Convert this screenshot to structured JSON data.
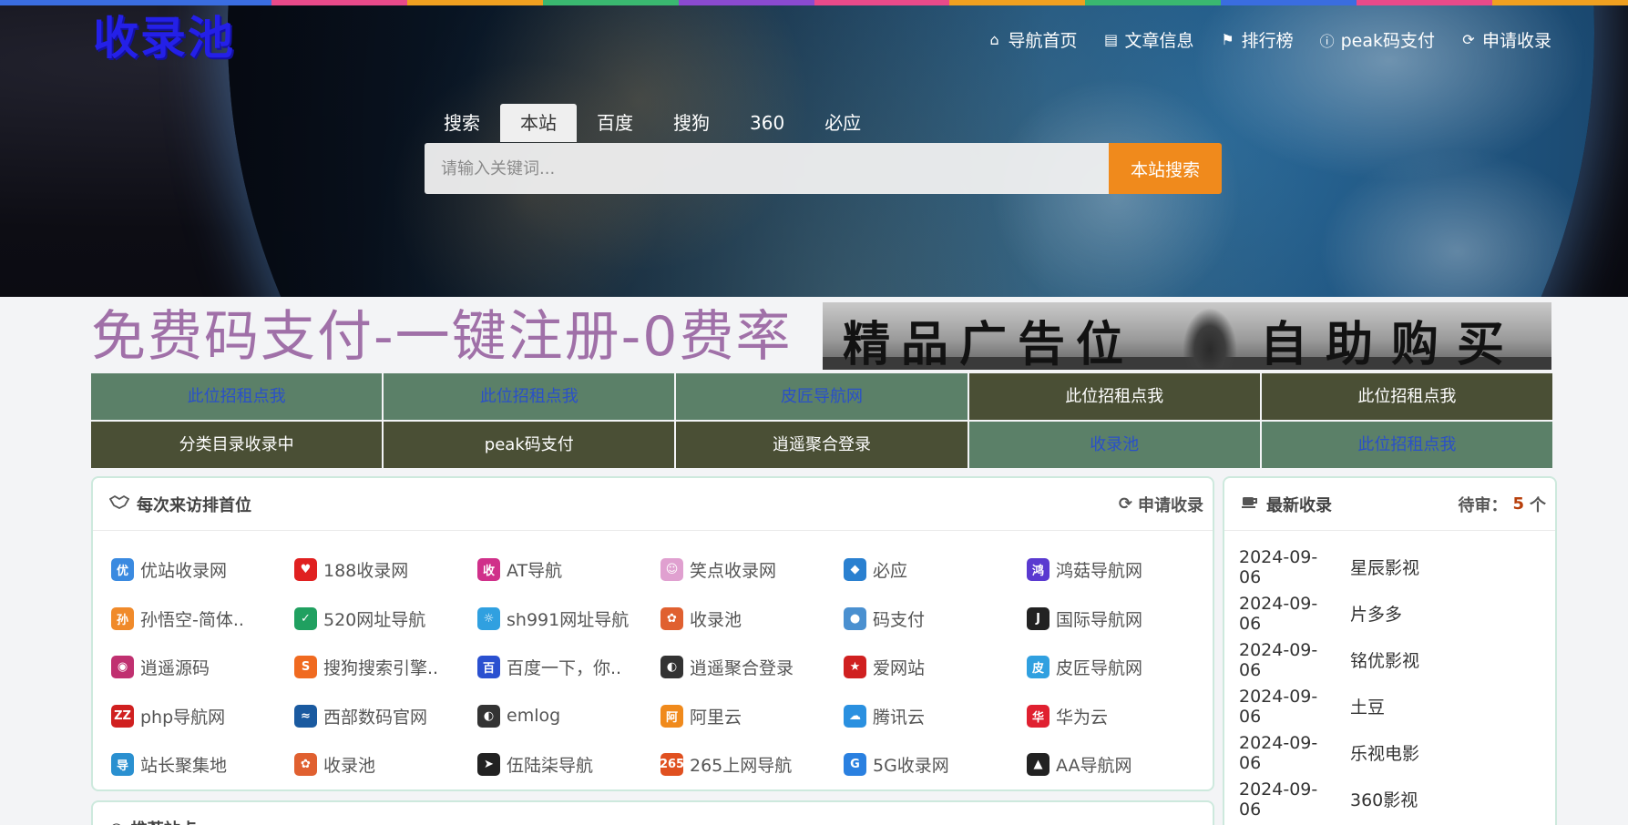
{
  "top_strip_colors": [
    "#3a6de0",
    "#3a6de0",
    "#e84a8a",
    "#f0a020",
    "#3ab870",
    "#8a4ad0",
    "#e84a8a",
    "#f0a020",
    "#3ab870",
    "#3a6de0",
    "#e84a8a",
    "#f0a020"
  ],
  "header": {
    "logo_text": "收录池",
    "nav": [
      {
        "icon": "home-icon",
        "glyph": "⌂",
        "label": "导航首页"
      },
      {
        "icon": "book-icon",
        "glyph": "▤",
        "label": "文章信息"
      },
      {
        "icon": "flag-icon",
        "glyph": "⚑",
        "label": "排行榜"
      },
      {
        "icon": "info-icon",
        "glyph": "ⓘ",
        "label": "peak码支付"
      },
      {
        "icon": "refresh-icon",
        "glyph": "⟳",
        "label": "申请收录"
      }
    ]
  },
  "search": {
    "tabs": [
      "搜索",
      "本站",
      "百度",
      "搜狗",
      "360",
      "必应"
    ],
    "active_tab": "本站",
    "placeholder": "请输入关键词...",
    "button_label": "本站搜索"
  },
  "ads": {
    "left_text": "免费码支付-一键注册-0费率",
    "right_text_1": "精品广告位",
    "right_text_2": "自助购买"
  },
  "rent_cells": [
    {
      "label": "此位招租点我",
      "style": "green"
    },
    {
      "label": "此位招租点我",
      "style": "green"
    },
    {
      "label": "皮匠导航网",
      "style": "green"
    },
    {
      "label": "此位招租点我",
      "style": "dark"
    },
    {
      "label": "此位招租点我",
      "style": "dark"
    },
    {
      "label": "分类目录收录中",
      "style": "dark"
    },
    {
      "label": "peak码支付",
      "style": "dark"
    },
    {
      "label": "逍遥聚合登录",
      "style": "dark"
    },
    {
      "label": "收录池",
      "style": "green"
    },
    {
      "label": "此位招租点我",
      "style": "green"
    }
  ],
  "main_panel": {
    "title": "每次来访排首位",
    "title_icon": "handshake-icon",
    "action_label": "申请收录",
    "sites": [
      {
        "name": "优站收录网",
        "color": "#3a8ae0",
        "glyph": "优"
      },
      {
        "name": "188收录网",
        "color": "#e02020",
        "glyph": "♥"
      },
      {
        "name": "AT导航",
        "color": "#d0308a",
        "glyph": "收"
      },
      {
        "name": "笑点收录网",
        "color": "#e0a0d0",
        "glyph": "☺"
      },
      {
        "name": "必应",
        "color": "#2a80d0",
        "glyph": "◆"
      },
      {
        "name": "鸿菇导航网",
        "color": "#5a3ad0",
        "glyph": "鸿"
      },
      {
        "name": "孙悟空-简体..",
        "color": "#f08a2a",
        "glyph": "孙"
      },
      {
        "name": "520网址导航",
        "color": "#20a060",
        "glyph": "✓"
      },
      {
        "name": "sh991网址导航",
        "color": "#30a0e0",
        "glyph": "☼"
      },
      {
        "name": "收录池",
        "color": "#e06030",
        "glyph": "✿"
      },
      {
        "name": "码支付",
        "color": "#4a90d0",
        "glyph": "●"
      },
      {
        "name": "国际导航网",
        "color": "#222222",
        "glyph": "J"
      },
      {
        "name": "逍遥源码",
        "color": "#c03070",
        "glyph": "◉"
      },
      {
        "name": "搜狗搜索引擎..",
        "color": "#f06a20",
        "glyph": "S"
      },
      {
        "name": "百度一下，你..",
        "color": "#2a50d0",
        "glyph": "百"
      },
      {
        "name": "逍遥聚合登录",
        "color": "#333333",
        "glyph": "◐"
      },
      {
        "name": "爱网站",
        "color": "#d02020",
        "glyph": "★"
      },
      {
        "name": "皮匠导航网",
        "color": "#30a0e0",
        "glyph": "皮"
      },
      {
        "name": "php导航网",
        "color": "#d02020",
        "glyph": "ZZ"
      },
      {
        "name": "西部数码官网",
        "color": "#1a5aa0",
        "glyph": "≈"
      },
      {
        "name": "emlog",
        "color": "#333333",
        "glyph": "◐"
      },
      {
        "name": "阿里云",
        "color": "#f08a1c",
        "glyph": "阿"
      },
      {
        "name": "腾讯云",
        "color": "#2a90e0",
        "glyph": "☁"
      },
      {
        "name": "华为云",
        "color": "#e02030",
        "glyph": "华"
      },
      {
        "name": "站长聚集地",
        "color": "#2a90d0",
        "glyph": "导"
      },
      {
        "name": "收录池",
        "color": "#e06030",
        "glyph": "✿"
      },
      {
        "name": "伍陆柒导航",
        "color": "#222222",
        "glyph": "➤"
      },
      {
        "name": "265上网导航",
        "color": "#e05020",
        "glyph": "265"
      },
      {
        "name": "5G收录网",
        "color": "#2a80e0",
        "glyph": "G"
      },
      {
        "name": "AA导航网",
        "color": "#222222",
        "glyph": "▲"
      }
    ]
  },
  "side_panel": {
    "title": "最新收录",
    "title_icon": "coffee-icon",
    "pending_label": "待审：",
    "pending_count": "5",
    "pending_unit": "个",
    "items": [
      {
        "date": "2024-09-06",
        "name": "星辰影视"
      },
      {
        "date": "2024-09-06",
        "name": "片多多"
      },
      {
        "date": "2024-09-06",
        "name": "铭优影视"
      },
      {
        "date": "2024-09-06",
        "name": "土豆"
      },
      {
        "date": "2024-09-06",
        "name": "乐视电影"
      },
      {
        "date": "2024-09-06",
        "name": "360影视"
      }
    ]
  },
  "bottom_panel": {
    "title": "推荐站点"
  }
}
